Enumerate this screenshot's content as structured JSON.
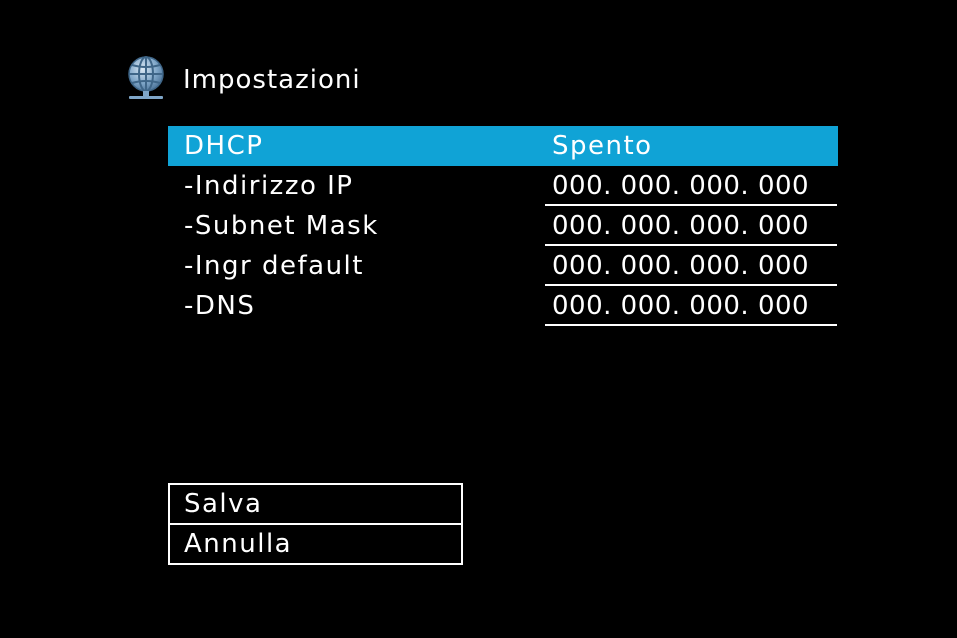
{
  "header": {
    "icon": "globe-network-icon",
    "title": "Impostazioni"
  },
  "settings": {
    "dhcp": {
      "label": "DHCP",
      "value": "Spento"
    },
    "ip_address": {
      "label": "-Indirizzo IP",
      "value": "000. 000. 000. 000"
    },
    "subnet_mask": {
      "label": "-Subnet Mask",
      "value": "000. 000. 000. 000"
    },
    "gateway": {
      "label": "-Ingr default",
      "value": "000. 000. 000. 000"
    },
    "dns": {
      "label": "-DNS",
      "value": "000. 000. 000. 000"
    }
  },
  "actions": {
    "save_label": "Salva",
    "cancel_label": "Annulla"
  },
  "colors": {
    "background": "#000000",
    "highlight": "#10a3d6",
    "text": "#ffffff"
  }
}
